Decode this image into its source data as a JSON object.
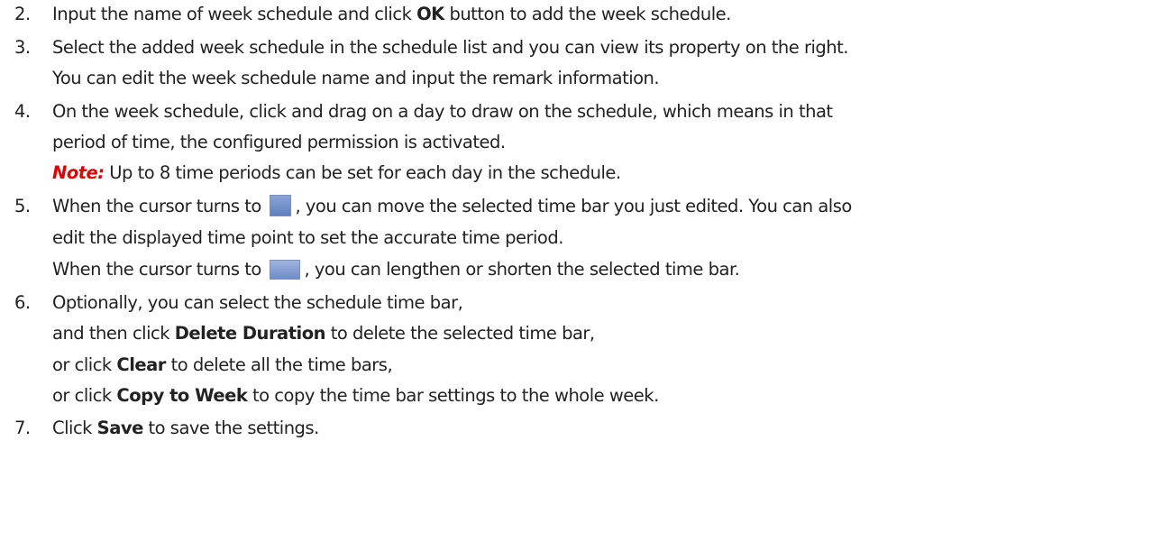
{
  "steps": [
    {
      "num": "2.",
      "lines": [
        [
          "Input the name of week schedule and click ",
          {
            "b": "OK"
          },
          " button to add the week schedule."
        ]
      ]
    },
    {
      "num": "3.",
      "lines": [
        [
          "Select the added week schedule in the schedule list and you can view its property on the right."
        ],
        [
          "You can edit the week schedule name and input the remark information."
        ]
      ]
    },
    {
      "num": "4.",
      "lines": [
        [
          "On the week schedule, click and drag on a day to draw on the schedule, which means in that"
        ],
        [
          "period of time, the configured permission is activated."
        ],
        [
          {
            "note": "Note:"
          },
          " Up to 8 time periods can be set for each day in the schedule."
        ]
      ]
    },
    {
      "num": "5.",
      "lines": [
        [
          "When the cursor turns to ",
          {
            "icon": "hand-cursor-icon"
          },
          ", you can move the selected time bar you just edited. You can also"
        ],
        [
          "edit the displayed time point to set the accurate time period."
        ],
        [
          "When the cursor turns to ",
          {
            "icon": "resize-cursor-icon"
          },
          ", you can lengthen or shorten the selected time bar."
        ]
      ]
    },
    {
      "num": "6.",
      "lines": [
        [
          "Optionally, you can select the schedule time bar,"
        ],
        [
          "and then click ",
          {
            "b": "Delete Duration"
          },
          " to delete the selected time bar,"
        ],
        [
          "or click ",
          {
            "b": "Clear"
          },
          " to delete all the time bars,"
        ],
        [
          "or click ",
          {
            "b": "Copy to Week"
          },
          " to copy the time bar settings to the whole week."
        ]
      ]
    },
    {
      "num": "7.",
      "lines": [
        [
          "Click ",
          {
            "b": "Save"
          },
          " to save the settings."
        ]
      ]
    }
  ]
}
